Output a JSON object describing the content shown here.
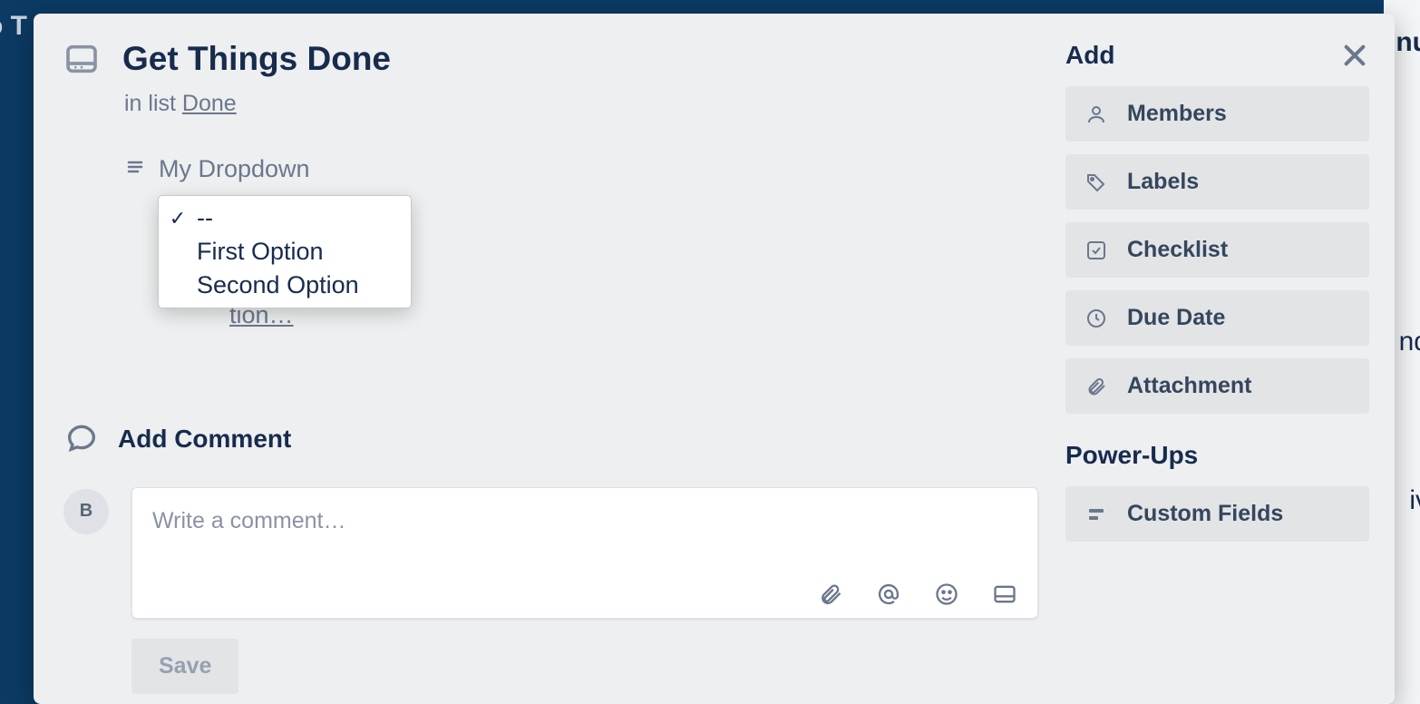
{
  "bg": {
    "t0": "o T",
    "t1": "nu",
    "t2": "nd",
    "t3": "iv"
  },
  "card": {
    "title": "Get Things Done",
    "in_list_prefix": "in list ",
    "list_name": "Done",
    "custom_field_label": "My Dropdown",
    "dropdown": {
      "options": [
        {
          "label": "--",
          "selected": true
        },
        {
          "label": "First Option",
          "selected": false
        },
        {
          "label": "Second Option",
          "selected": false
        }
      ]
    },
    "description_hint": "tion…"
  },
  "comment": {
    "heading": "Add Comment",
    "avatar_initial": "B",
    "placeholder": "Write a comment…",
    "save_label": "Save"
  },
  "sidebar": {
    "add_heading": "Add",
    "buttons": [
      {
        "label": "Members",
        "icon": "user"
      },
      {
        "label": "Labels",
        "icon": "tag"
      },
      {
        "label": "Checklist",
        "icon": "checklist"
      },
      {
        "label": "Due Date",
        "icon": "clock"
      },
      {
        "label": "Attachment",
        "icon": "attachment"
      }
    ],
    "powerups_heading": "Power-Ups",
    "powerup_buttons": [
      {
        "label": "Custom Fields",
        "icon": "fields"
      }
    ]
  }
}
